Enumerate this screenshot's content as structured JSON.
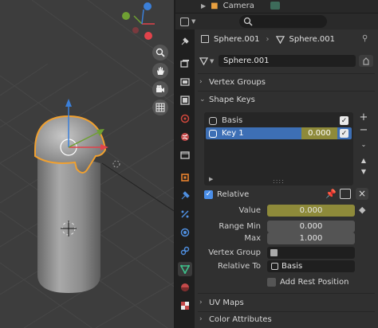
{
  "outliner": {
    "row_label": "Camera"
  },
  "header": {
    "object_name": "Sphere.001",
    "mesh_name": "Sphere.001"
  },
  "data_block": {
    "value": "Sphere.001"
  },
  "panels": {
    "vertex_groups": "Vertex Groups",
    "shape_keys": "Shape Keys",
    "uv_maps": "UV Maps",
    "color_attributes": "Color Attributes"
  },
  "shape_keys": {
    "items": [
      {
        "name": "Basis",
        "value": ""
      },
      {
        "name": "Key 1",
        "value": "0.000"
      }
    ]
  },
  "relative": {
    "label": "Relative"
  },
  "properties": {
    "value_label": "Value",
    "value": "0.000",
    "range_min_label": "Range Min",
    "range_min": "0.000",
    "max_label": "Max",
    "max": "1.000",
    "vertex_group_label": "Vertex Group",
    "vertex_group": "",
    "relative_to_label": "Relative To",
    "relative_to": "Basis",
    "add_rest_label": "Add Rest Position"
  },
  "colors": {
    "accent_blue": "#4a8ee8",
    "selected_row": "#3d6fb5",
    "value_slider": "#8e8a3a",
    "outline_orange": "#f0a030",
    "axis_red": "#e2434b",
    "axis_green": "#6fa033",
    "axis_blue": "#3b7fd8"
  },
  "icons": {
    "nav": [
      "zoom-icon",
      "hand-pan-icon",
      "camera-view-icon",
      "grid-icon"
    ],
    "tabs": [
      "tool-icon",
      "render-icon",
      "output-icon",
      "view-layer-icon",
      "scene-icon",
      "world-icon",
      "collection-icon",
      "object-icon",
      "modifier-icon",
      "particles-icon",
      "physics-icon",
      "constraints-icon",
      "data-icon",
      "material-icon",
      "texture-icon"
    ]
  }
}
